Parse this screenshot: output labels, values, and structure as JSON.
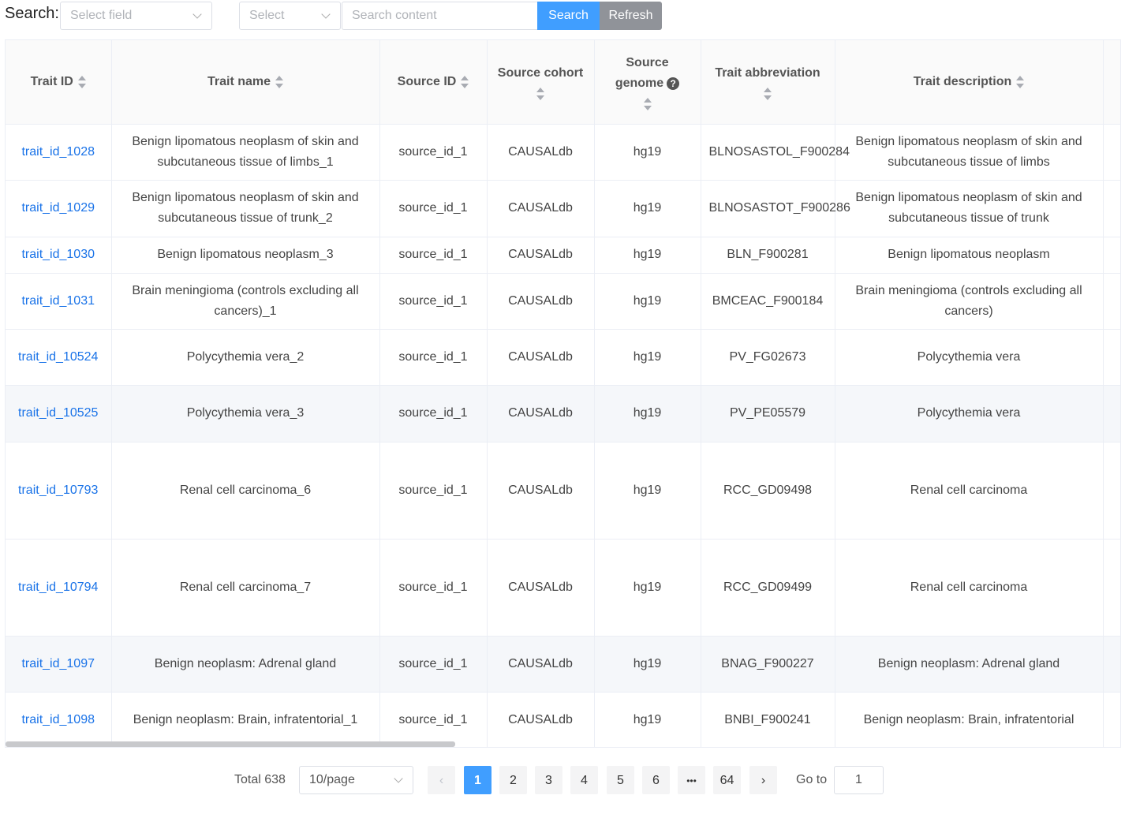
{
  "search": {
    "label": "Search:",
    "field_placeholder": "Select field",
    "operator_placeholder": "Select",
    "input_placeholder": "Search content",
    "search_label": "Search",
    "refresh_label": "Refresh"
  },
  "table": {
    "columns": {
      "trait_id": "Trait ID",
      "trait_name": "Trait name",
      "source_id": "Source ID",
      "source_cohort": "Source cohort",
      "source_genome": "Source genome",
      "trait_abbreviation": "Trait abbreviation",
      "trait_description": "Trait description"
    },
    "help_glyph": "?",
    "rows": [
      {
        "trait_id": "trait_id_1028",
        "trait_name": "Benign lipomatous neoplasm of skin and subcutaneous tissue of limbs_1",
        "source_id": "source_id_1",
        "source_cohort": "CAUSALdb",
        "source_genome": "hg19",
        "trait_abbreviation": "BLNOSASTOL_F900284",
        "trait_description": "Benign lipomatous neoplasm of skin and subcutaneous tissue of limbs"
      },
      {
        "trait_id": "trait_id_1029",
        "trait_name": "Benign lipomatous neoplasm of skin and subcutaneous tissue of trunk_2",
        "source_id": "source_id_1",
        "source_cohort": "CAUSALdb",
        "source_genome": "hg19",
        "trait_abbreviation": "BLNOSASTOT_F900286",
        "trait_description": "Benign lipomatous neoplasm of skin and subcutaneous tissue of trunk"
      },
      {
        "trait_id": "trait_id_1030",
        "trait_name": "Benign lipomatous neoplasm_3",
        "source_id": "source_id_1",
        "source_cohort": "CAUSALdb",
        "source_genome": "hg19",
        "trait_abbreviation": "BLN_F900281",
        "trait_description": "Benign lipomatous neoplasm"
      },
      {
        "trait_id": "trait_id_1031",
        "trait_name": "Brain meningioma (controls excluding all cancers)_1",
        "source_id": "source_id_1",
        "source_cohort": "CAUSALdb",
        "source_genome": "hg19",
        "trait_abbreviation": "BMCEAC_F900184",
        "trait_description": "Brain meningioma (controls excluding all cancers)"
      },
      {
        "trait_id": "trait_id_10524",
        "trait_name": "Polycythemia vera_2",
        "source_id": "source_id_1",
        "source_cohort": "CAUSALdb",
        "source_genome": "hg19",
        "trait_abbreviation": "PV_FG02673",
        "trait_description": "Polycythemia vera"
      },
      {
        "trait_id": "trait_id_10525",
        "trait_name": "Polycythemia vera_3",
        "source_id": "source_id_1",
        "source_cohort": "CAUSALdb",
        "source_genome": "hg19",
        "trait_abbreviation": "PV_PE05579",
        "trait_description": "Polycythemia vera"
      },
      {
        "trait_id": "trait_id_10793",
        "trait_name": "Renal cell carcinoma_6",
        "source_id": "source_id_1",
        "source_cohort": "CAUSALdb",
        "source_genome": "hg19",
        "trait_abbreviation": "RCC_GD09498",
        "trait_description": "Renal cell carcinoma"
      },
      {
        "trait_id": "trait_id_10794",
        "trait_name": "Renal cell carcinoma_7",
        "source_id": "source_id_1",
        "source_cohort": "CAUSALdb",
        "source_genome": "hg19",
        "trait_abbreviation": "RCC_GD09499",
        "trait_description": "Renal cell carcinoma"
      },
      {
        "trait_id": "trait_id_1097",
        "trait_name": "Benign neoplasm: Adrenal gland",
        "source_id": "source_id_1",
        "source_cohort": "CAUSALdb",
        "source_genome": "hg19",
        "trait_abbreviation": "BNAG_F900227",
        "trait_description": "Benign neoplasm: Adrenal gland"
      },
      {
        "trait_id": "trait_id_1098",
        "trait_name": "Benign neoplasm: Brain, infratentorial_1",
        "source_id": "source_id_1",
        "source_cohort": "CAUSALdb",
        "source_genome": "hg19",
        "trait_abbreviation": "BNBI_F900241",
        "trait_description": "Benign neoplasm: Brain, infratentorial"
      }
    ]
  },
  "pagination": {
    "total_text": "Total 638",
    "page_size": "10/page",
    "prev_glyph": "‹",
    "next_glyph": "›",
    "pages": [
      "1",
      "2",
      "3",
      "4",
      "5",
      "6"
    ],
    "ellipsis": "•••",
    "last_page": "64",
    "current_page": "1",
    "goto_label": "Go to",
    "goto_value": "1"
  }
}
